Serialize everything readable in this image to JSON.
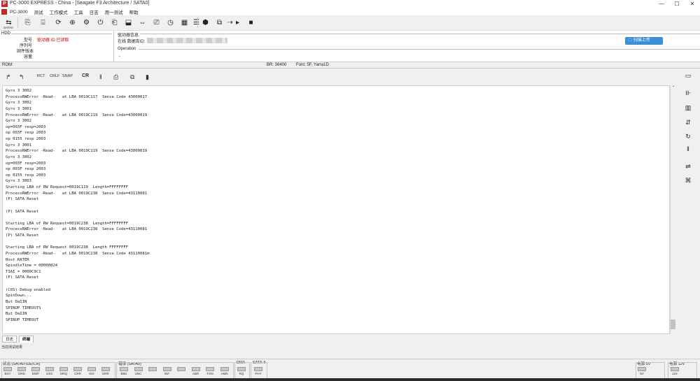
{
  "window": {
    "title": "PC-3000 EXPRESS - China - [Seagate F3 Architecture / SATA0]",
    "minimize": "—",
    "maximize": "☐",
    "close": "✕"
  },
  "menu": {
    "app_logo": "PC",
    "items": [
      "PC-3000",
      "测试",
      "工作模式",
      "工具",
      "日志",
      "用一测试",
      "帮助"
    ]
  },
  "toolbar": {
    "items": [
      "⇆",
      "⎘",
      "⌹",
      "⟳",
      "⊕",
      "⚙",
      "⏻",
      "⎗",
      "⬓",
      "⇔",
      "⎚",
      "◷",
      "▦",
      "☰",
      "⬢",
      "⧉",
      "⇢",
      "▸",
      "■"
    ],
    "first_sublabel": "SATA0"
  },
  "info": {
    "left_group_title": "HDD",
    "fields": [
      "型号",
      "序列号",
      "固件版本",
      "容量"
    ],
    "model_value": "驱动器 ID 已读取",
    "drive_group_title": "驱动器信息",
    "drive_label": "在线 数据库ID:",
    "operation_label": "Operation",
    "operation_value": "-",
    "upload_button": "扫描上传",
    "upload_icon": "cloud-upload-icon"
  },
  "status": {
    "rom_label": "ROM:",
    "br_label": "BR: 38400",
    "font_label": "Font: 5F, Yarra1D"
  },
  "terminal_toolbar": {
    "buttons": [
      "↱",
      "↰"
    ],
    "text_buttons": [
      "RCT",
      "CRLF",
      "SNAP",
      "CR"
    ],
    "pause": "‖",
    "print": "⎙",
    "copy": "⧉",
    "clear": "▮"
  },
  "log": [
    "Gyro 3 3002",
    "ProcessRWError -Read-   at LBA 0019C117  Sense Code 43000017",
    "Gyro 3 3002",
    "Gyro 3 3001",
    "ProcessRWError -Read-   at LBA 0019C119  Sense Code=43000019",
    "Gyro 3 3002",
    "op=003F resp=2003",
    "op 003F resp 2003",
    "op 0155 resp 2003",
    "Gyro 3 3001",
    "ProcessRWError -Read-   at LBA 0019C119  Sense Code=43000019",
    "Gyro 3 3002",
    "op=003F resp=2003",
    "op 003F resp 2003",
    "op 0155 resp 2003",
    "Gyro 3 3003",
    "Starting LBA of RW Request=0019C119  Length=FFFFFFFF",
    "ProcessRWError -Read-   at LBA 0019C238  Sense Code=43110081",
    "(P) SATA Reset",
    "",
    "(P) SATA Reset",
    "",
    "Starting LBA of RW Request=0019C238  Length=FFFFFFFF",
    "ProcessRWError -Read-   at LBA 0019C238  Sense Code=43110081",
    "(P) SATA Reset",
    "",
    "Starting LBA of RW Request 0019C238  Length FFFFFFFF",
    "ProcessRWError -Read-   at LBA 0019C238  Sense Code 43110081m",
    "Host RATER",
    "SpindleTime = 00000824",
    "TIAI = 0000C9C1",
    "(P) SATA Reset",
    "",
    "(C0S) Debug enabled",
    "SpinDown...",
    "But DaIIN",
    "SPINUP TIMEOUTS",
    "But DaIIN",
    "SPINUP TIMEOUT"
  ],
  "right_toolbar": [
    "▭",
    "⊪",
    "▥",
    "⇵",
    "↻",
    "‖",
    "⇌",
    "⌘"
  ],
  "tabs": [
    "日志",
    "终端"
  ],
  "bottom_label": "当前测试结果",
  "bottom": {
    "group1_title": "状态 (SATA0-IDE/CH)",
    "group1_leds": [
      "BSY",
      "DRD",
      "DWF",
      "DSC",
      "DRQ",
      "CRR",
      "IDX",
      "ERR"
    ],
    "group2_title": "错误 (SATA0)",
    "group2_leds": [
      "BBK",
      "UNC",
      "",
      "INF",
      "",
      "ABR",
      "TON",
      "AMN"
    ],
    "group3_title": "DMA",
    "group3_leds": [
      "RQ"
    ],
    "group4_title": "SATA-II",
    "group4_leds": [
      "PHY"
    ],
    "right1_title": "电源 5V",
    "right1_leds": [
      "5V"
    ],
    "right2_title": "电源 12V",
    "right2_leds": [
      "12V"
    ]
  }
}
